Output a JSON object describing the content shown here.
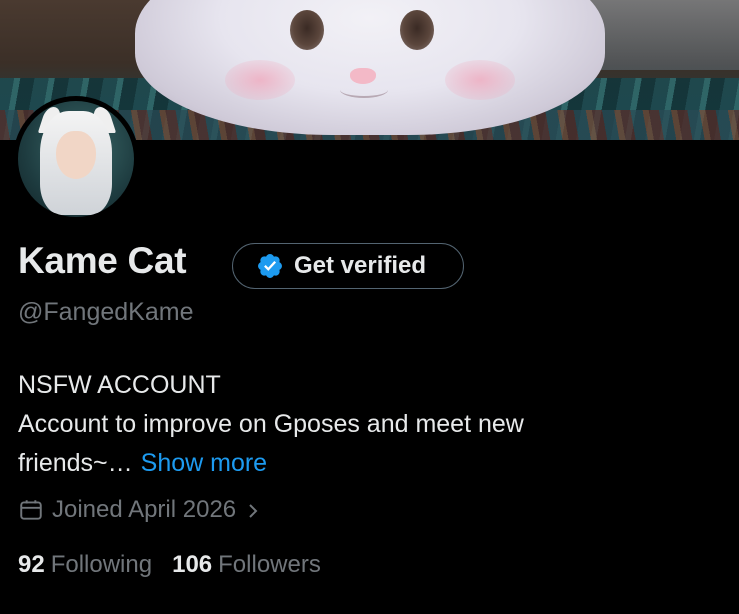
{
  "profile": {
    "display_name": "Kame Cat",
    "handle": "@FangedKame",
    "verify_button_label": "Get verified",
    "bio_line1": "NSFW ACCOUNT",
    "bio_line2": "Account to improve on Gposes and meet new",
    "bio_line3": "friends~…",
    "show_more_label": "Show more",
    "joined": "Joined April 2026",
    "following_count": "92",
    "following_label": "Following",
    "followers_count": "106",
    "followers_label": "Followers"
  },
  "colors": {
    "background": "#000000",
    "text_primary": "#e7e9ea",
    "text_secondary": "#71767b",
    "link": "#1d9bf0",
    "verified_badge": "#1d9bf0"
  },
  "icons": {
    "verify": "verified-badge-icon",
    "calendar": "calendar-icon",
    "joined_chevron": "chevron-right-icon"
  }
}
